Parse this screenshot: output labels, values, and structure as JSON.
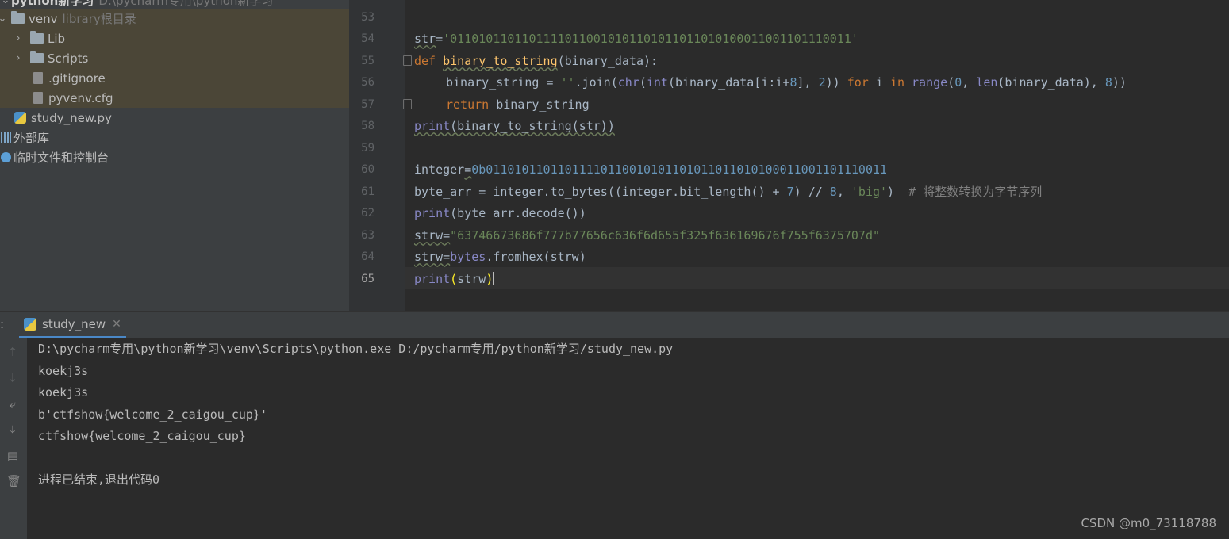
{
  "project": {
    "root_name": "python新学习",
    "root_path": "D:\\pycharm专用\\python新学习",
    "venv_label": "venv",
    "venv_note": "library根目录",
    "items": [
      {
        "label": "Lib"
      },
      {
        "label": "Scripts"
      },
      {
        "label": ".gitignore"
      },
      {
        "label": "pyvenv.cfg"
      },
      {
        "label": "study_new.py"
      },
      {
        "label": "外部库"
      },
      {
        "label": "临时文件和控制台"
      }
    ]
  },
  "editor": {
    "line_numbers": [
      "53",
      "54",
      "55",
      "56",
      "57",
      "58",
      "59",
      "60",
      "61",
      "62",
      "63",
      "64",
      "65"
    ],
    "l54": {
      "a": "str",
      "b": "=",
      "c": "'01101011011011110110010101101011011010100011001101110011'"
    },
    "l55": {
      "a": "def",
      "b": "binary_to_string",
      "c": "(binary_data):"
    },
    "l56": {
      "a": "binary_string = ",
      "b": "''",
      "c": ".join(",
      "d": "chr",
      "e": "(",
      "f": "int",
      "g": "(binary_data[i:i+",
      "h": "8",
      "i": "], ",
      "j": "2",
      "k": ")) ",
      "l": "for",
      "m": " i ",
      "n": "in",
      "o": " ",
      "p": "range",
      "q": "(",
      "r": "0",
      "s": ", ",
      "t": "len",
      "u": "(binary_data), ",
      "v": "8",
      "w": "))"
    },
    "l57": {
      "a": "return",
      "b": " binary_string"
    },
    "l58": {
      "a": "print",
      "b": "(binary_to_string(str))"
    },
    "l60": {
      "a": "integer",
      "b": "=",
      "c": "0b01101011011011110110010101101011011010100011001101110011"
    },
    "l61": {
      "a": "byte_arr = integer.to_bytes((integer.bit_length() + ",
      "b": "7",
      "c": ") // ",
      "d": "8",
      "e": ", ",
      "f": "'big'",
      "g": ")  ",
      "h": "# 将整数转换为字节序列"
    },
    "l62": {
      "a": "print",
      "b": "(byte_arr.decode())"
    },
    "l63": {
      "a": "strw",
      "b": "=",
      "c": "\"63746673686f777b77656c636f6d655f325f636169676f755f6375707d\""
    },
    "l64": {
      "a": "strw",
      "b": "=",
      "c": "bytes",
      "d": ".fromhex(strw)"
    },
    "l65": {
      "a": "print",
      "b": "(",
      "c": "strw",
      "d": ")"
    }
  },
  "run": {
    "side_label": ":",
    "tab_label": "study_new",
    "output": [
      "D:\\pycharm专用\\python新学习\\venv\\Scripts\\python.exe D:/pycharm专用/python新学习/study_new.py",
      "koekj3s",
      "koekj3s",
      "b'ctfshow{welcome_2_caigou_cup}'",
      "ctfshow{welcome_2_caigou_cup}",
      "",
      "进程已结束,退出代码0"
    ]
  },
  "watermark": "CSDN @m0_73118788",
  "icons": [
    "chevron-down-icon",
    "chevron-right-icon",
    "folder-icon",
    "file-icon",
    "python-file-icon",
    "library-icon",
    "scratch-icon",
    "python-run-icon",
    "close-icon",
    "up-arrow-icon",
    "down-arrow-icon",
    "soft-wrap-icon",
    "scroll-end-icon",
    "print-icon",
    "trash-icon"
  ]
}
